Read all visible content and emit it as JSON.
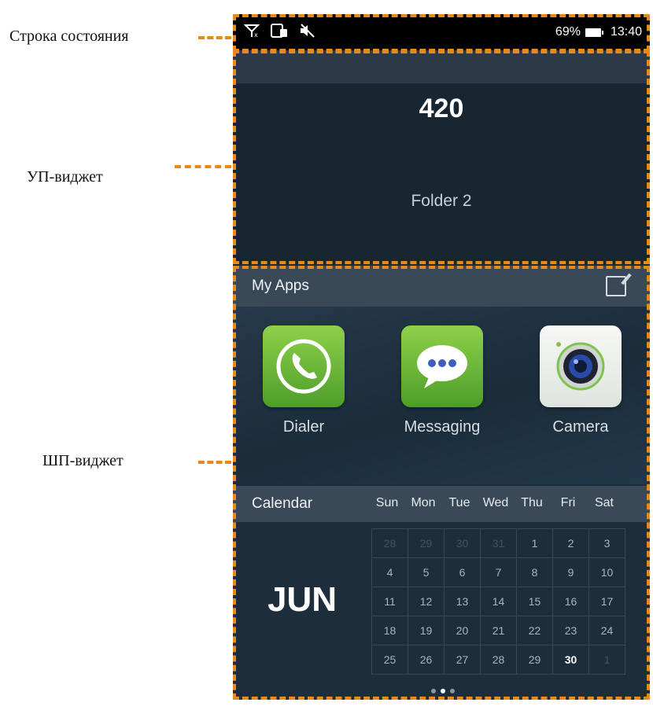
{
  "annotations": {
    "status_bar_label": "Строка состояния",
    "up_widget_label": "УП-виджет",
    "shp_widget_label": "ШП-виджет"
  },
  "status_bar": {
    "battery_text": "69%",
    "time": "13:40",
    "icons": [
      "no-signal-icon",
      "sim-icon",
      "mute-icon",
      "battery-icon"
    ]
  },
  "folder_widget": {
    "count": "420",
    "name": "Folder 2"
  },
  "apps_widget": {
    "title": "My Apps",
    "edit_icon": "edit-icon",
    "apps": [
      {
        "label": "Dialer",
        "icon": "phone-icon"
      },
      {
        "label": "Messaging",
        "icon": "chat-bubble-icon"
      },
      {
        "label": "Camera",
        "icon": "camera-icon"
      }
    ]
  },
  "calendar_widget": {
    "title": "Calendar",
    "days_of_week": [
      "Sun",
      "Mon",
      "Tue",
      "Wed",
      "Thu",
      "Fri",
      "Sat"
    ],
    "month": "JUN",
    "weeks": [
      [
        "28",
        "29",
        "30",
        "31",
        "1",
        "2",
        "3"
      ],
      [
        "4",
        "5",
        "6",
        "7",
        "8",
        "9",
        "10"
      ],
      [
        "11",
        "12",
        "13",
        "14",
        "15",
        "16",
        "17"
      ],
      [
        "18",
        "19",
        "20",
        "21",
        "22",
        "23",
        "24"
      ],
      [
        "25",
        "26",
        "27",
        "28",
        "29",
        "30",
        "1"
      ]
    ],
    "today": "30",
    "page_count": 3,
    "active_page": 2
  },
  "colors": {
    "annotation_dash": "#e88a1a",
    "widget_header": "#3a4957",
    "widget_body": "#1d2d3b"
  }
}
